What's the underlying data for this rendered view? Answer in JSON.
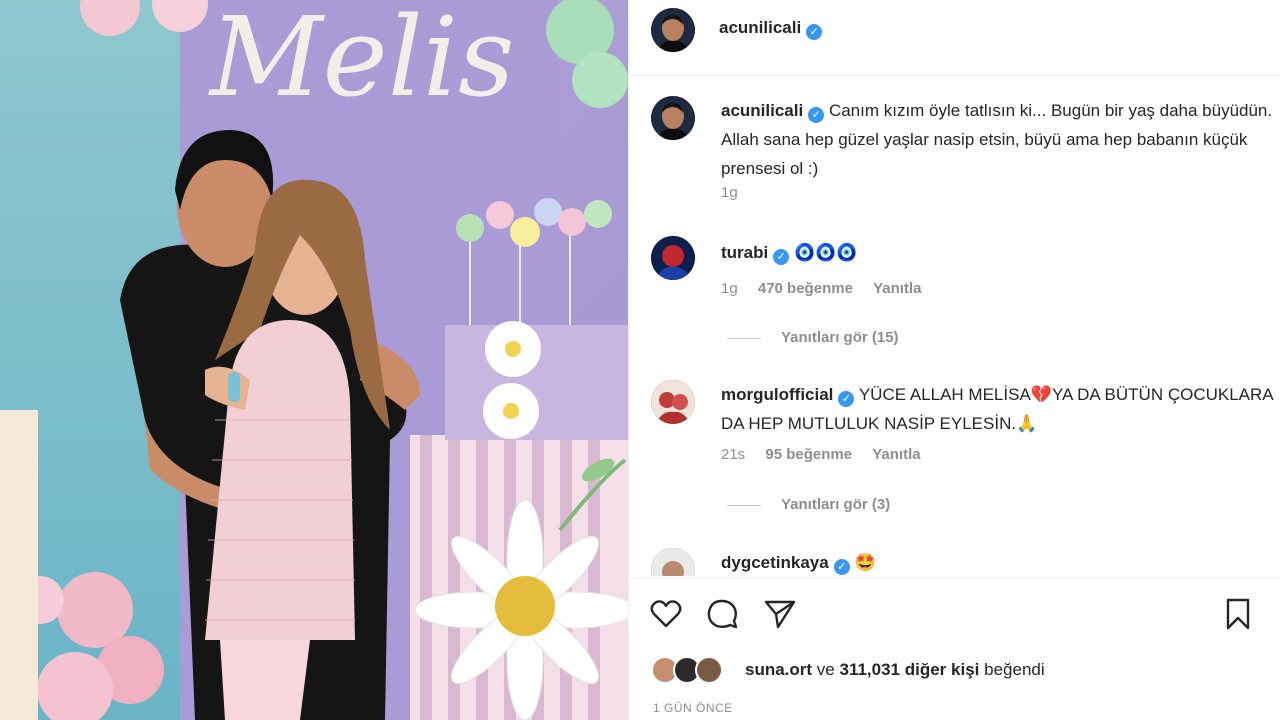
{
  "post": {
    "author": "acunilicali",
    "photo_sign_text": "Melis"
  },
  "caption": {
    "username": "acunilicali",
    "text": "Canım kızım öyle tatlısın ki... Bugün bir yaş daha büyüdün. Allah sana hep güzel yaşlar nasip etsin, büyü ama hep babanın küçük prensesi ol :)",
    "time": "1g"
  },
  "comments": [
    {
      "username": "turabi",
      "text": "🧿🧿🧿",
      "time": "1g",
      "likes": "470 beğenme",
      "reply": "Yanıtla",
      "view_replies": "Yanıtları gör (15)"
    },
    {
      "username": "morgulofficial",
      "text": "YÜCE ALLAH MELİSA💔YA DA BÜTÜN ÇOCUKLARA DA HEP MUTLULUK NASİP EYLESİN.🙏",
      "time": "21s",
      "likes": "95 beğenme",
      "reply": "Yanıtla",
      "view_replies": "Yanıtları gör (3)"
    },
    {
      "username": "dygcetinkaya",
      "text": "🤩"
    }
  ],
  "actions": {
    "like_icon": "heart-icon",
    "comment_icon": "comment-icon",
    "share_icon": "share-icon",
    "save_icon": "bookmark-icon"
  },
  "likes_summary": {
    "first_user": "suna.ort",
    "connector": "ve",
    "others": "311,031 diğer kişi",
    "suffix": "beğendi"
  },
  "timestamp": "1 GÜN ÖNCE",
  "colors": {
    "verified": "#3897f0",
    "muted": "#8e8e8e",
    "text": "#262626"
  }
}
